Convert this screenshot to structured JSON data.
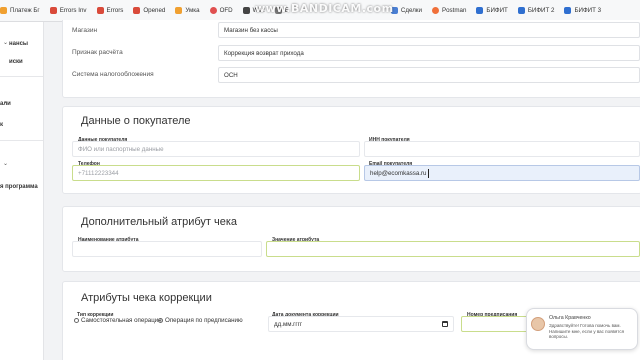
{
  "bookmarks": [
    {
      "label": "Платеж Бг",
      "color": "#f0a030"
    },
    {
      "label": "Errors Inv",
      "color": "#d94a3a"
    },
    {
      "label": "Errors",
      "color": "#d94a3a"
    },
    {
      "label": "Opened",
      "color": "#d94a3a"
    },
    {
      "label": "Умка",
      "color": "#f0a030"
    },
    {
      "label": "OFD",
      "color": "#e05050"
    },
    {
      "label": "Waz",
      "color": "#444444"
    },
    {
      "label": "Б",
      "color": "#7a7a7a"
    },
    {
      "label": "",
      "color": "#4a7fd4"
    },
    {
      "label": "Сделки",
      "color": "#4a7fd4"
    },
    {
      "label": "Postman",
      "color": "#f0703a"
    },
    {
      "label": "БИФИТ",
      "color": "#2f6fd0"
    },
    {
      "label": "БИФИТ 2",
      "color": "#2f6fd0"
    },
    {
      "label": "БИФИТ 3",
      "color": "#2f6fd0"
    }
  ],
  "watermark": "www.BANDICAM.com",
  "sidebar": {
    "items": [
      "нансы",
      "иски",
      "али",
      "к",
      "я программа"
    ]
  },
  "top_rows": [
    {
      "label": "Магазин",
      "value": "Магазин без кассы"
    },
    {
      "label": "Признак расчёта",
      "value": "Коррекция возврат прихода"
    },
    {
      "label": "Система налогообложения",
      "value": "ОСН"
    }
  ],
  "buyer": {
    "title": "Данные о покупателе",
    "name_label": "Данные покупателя",
    "name_placeholder": "ФИО или паспортные данные",
    "inn_label": "ИНН покупателя",
    "phone_label": "Телефон",
    "phone_placeholder": "+71112223344",
    "email_label": "Email покупателя",
    "email_value": "help@ecomkassa.ru"
  },
  "extra": {
    "title": "Дополнительный атрибут чека",
    "name_label": "Наименование атрибута",
    "value_label": "Значение атрибута"
  },
  "correction": {
    "title": "Атрибуты чека коррекции",
    "type_label": "Тип коррекции",
    "option_self": "Самостоятельная операция",
    "option_order": "Операция по предписанию",
    "date_label": "Дата документа коррекции",
    "date_placeholder": "дд.мм.гггг",
    "number_label": "Номер предписания"
  },
  "chat": {
    "name": "Ольга Кравченко",
    "message": "Здравствуйте! Готова помочь вам. Напишите мне, если у вас появятся вопросы."
  }
}
